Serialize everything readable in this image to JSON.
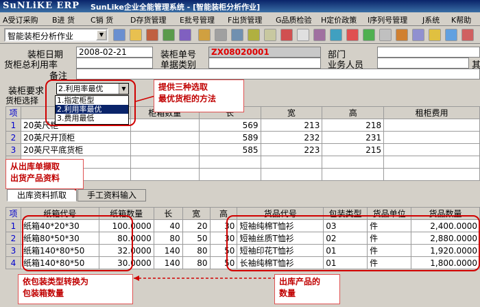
{
  "window": {
    "logo": "SuNLiKE ERP",
    "title": "SunLike企业全能管理系统 - [智能装柜分析作业]"
  },
  "menu": [
    "A受订采购",
    "B进 货",
    "C销 货",
    "D存货管理",
    "E批号管理",
    "F出货管理",
    "G品质检验",
    "H定价政策",
    "I序列号管理",
    "J系统",
    "K帮助"
  ],
  "toolbar": {
    "module_combo": "智能装柜分析作业"
  },
  "header": {
    "date_label": "装柜日期",
    "date_value": "2008-02-21",
    "no_label": "装柜单号",
    "no_value": "ZX08020001",
    "dept_label": "部门",
    "profit_label": "货柜总利用率",
    "doc_type_label": "单据类别",
    "sales_label": "业务人员",
    "remark_label": "备注",
    "cut_label": "其"
  },
  "requirement": {
    "label": "装柜要求",
    "selected": "2.利用率最优",
    "options": [
      "1.指定柜型",
      "2.利用率最优",
      "3.费用最低"
    ]
  },
  "container_grid": {
    "section_label": "货柜选择",
    "columns": [
      "项",
      "",
      "柜箱数量",
      "长",
      "宽",
      "高",
      "租柜费用"
    ],
    "rows": [
      {
        "no": "1",
        "name": "20英尺柜",
        "length": "569",
        "width": "213",
        "height": "218"
      },
      {
        "no": "2",
        "name": "20英尺开顶柜",
        "length": "589",
        "width": "232",
        "height": "231"
      },
      {
        "no": "3",
        "name": "20英尺平底货柜",
        "length": "585",
        "width": "223",
        "height": "215"
      }
    ]
  },
  "tabs": [
    "出库资料抓取",
    "手工资料输入"
  ],
  "carton_grid": {
    "columns": [
      "项",
      "纸箱代号",
      "纸箱数量",
      "长",
      "宽",
      "高",
      "货品代号",
      "包装类型",
      "货品单位",
      "货品数量"
    ],
    "rows": [
      {
        "no": "1",
        "carton": "纸箱40*20*30",
        "qty": "100.0000",
        "l": "40",
        "w": "20",
        "h": "30",
        "product": "短袖纯棉T恤衫",
        "pack": "03",
        "unit": "件",
        "amount": "2,400.0000"
      },
      {
        "no": "2",
        "carton": "纸箱80*50*30",
        "qty": "80.0000",
        "l": "80",
        "w": "50",
        "h": "30",
        "product": "短袖丝质T恤衫",
        "pack": "02",
        "unit": "件",
        "amount": "2,880.0000"
      },
      {
        "no": "3",
        "carton": "纸箱140*80*50",
        "qty": "32.0000",
        "l": "140",
        "w": "80",
        "h": "50",
        "product": "短袖印花T恤衫",
        "pack": "01",
        "unit": "件",
        "amount": "1,920.0000"
      },
      {
        "no": "4",
        "carton": "纸箱140*80*50",
        "qty": "30.0000",
        "l": "140",
        "w": "80",
        "h": "50",
        "product": "长袖纯棉T恤衫",
        "pack": "01",
        "unit": "件",
        "amount": "1,800.0000"
      }
    ]
  },
  "annotations": {
    "method": "提供三种选取\n最优货柜的方法",
    "extract": "从出库单撷取\n出货产品资料",
    "convert": "依包装类型转换为\n包装箱数量",
    "outqty": "出库产品的\n数量"
  },
  "colors": {
    "callout_text": "#c00000",
    "highlight": "#d00000",
    "doc_no": "#e00000",
    "selection": "#0a246a"
  }
}
